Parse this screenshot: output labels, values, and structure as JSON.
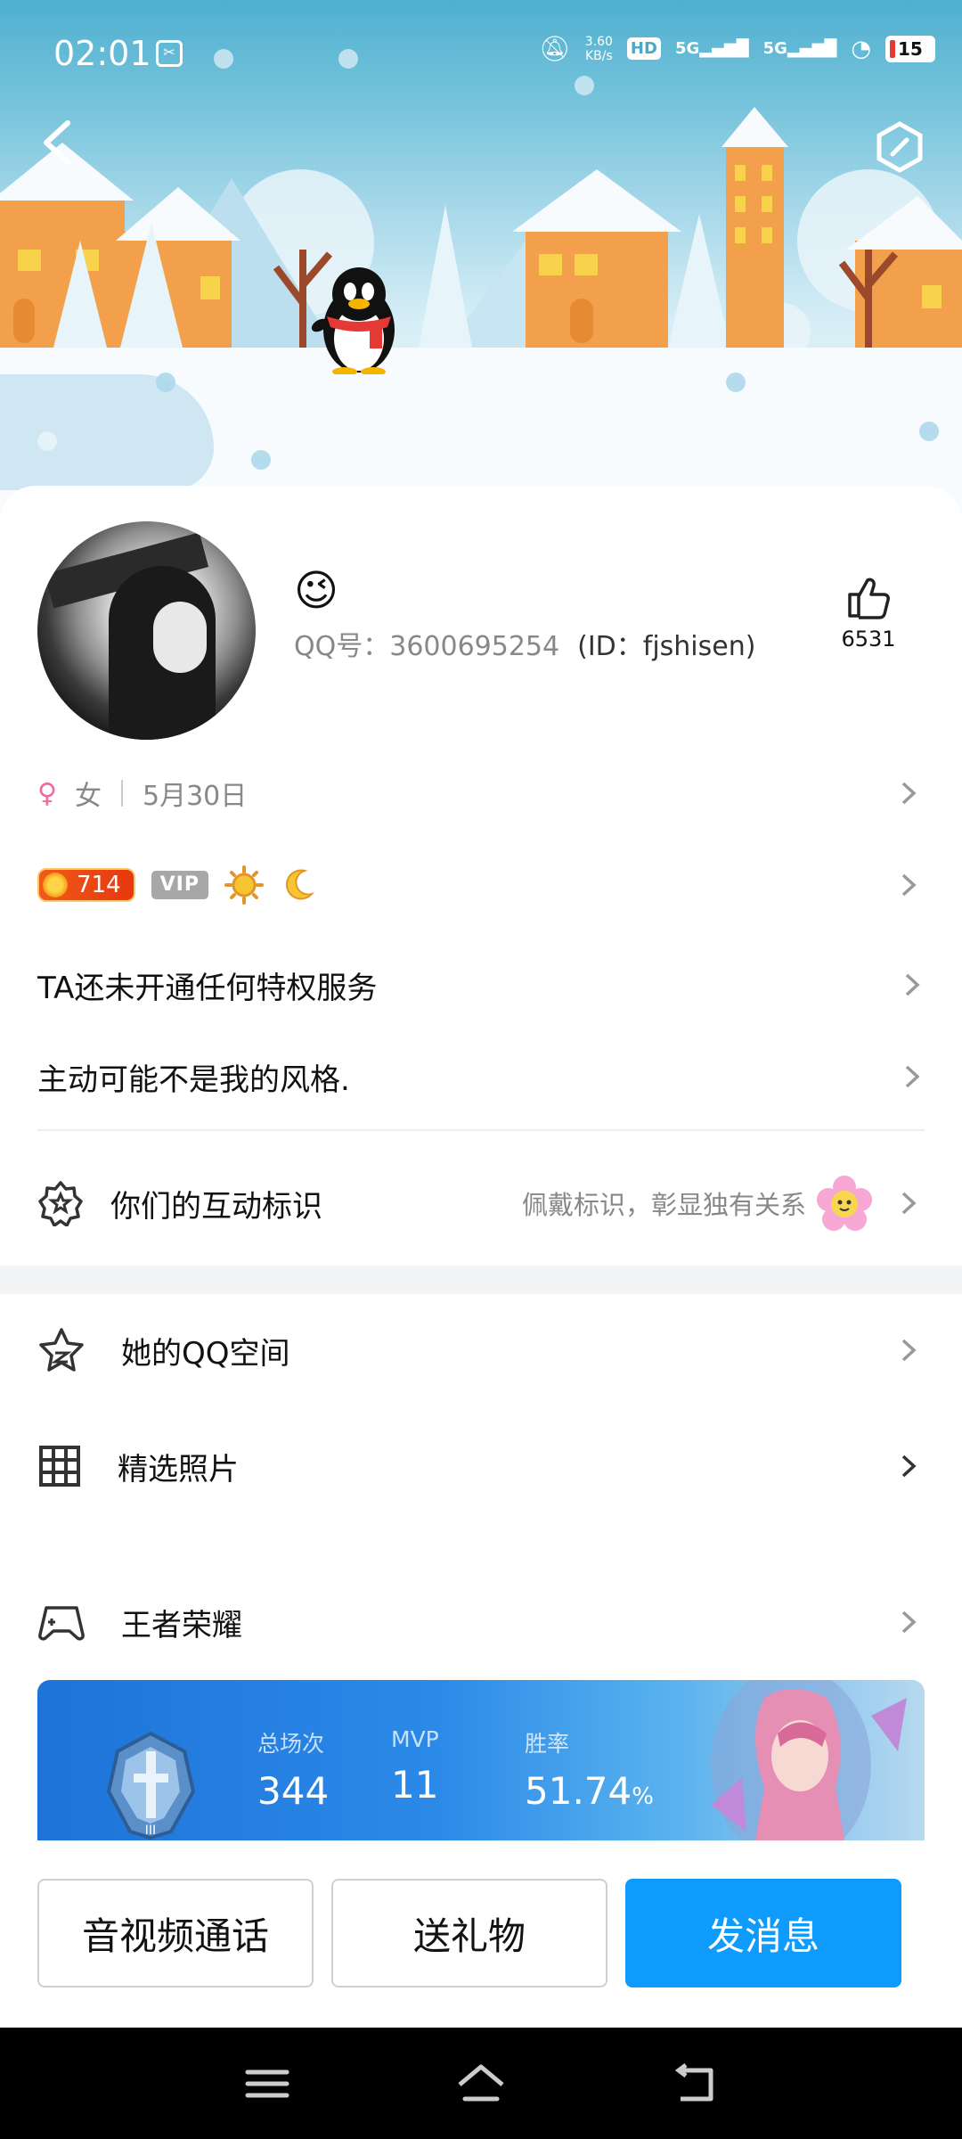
{
  "status_bar": {
    "time": "02:01",
    "net_speed_value": "3.60",
    "net_speed_unit": "KB/s",
    "hd_label": "HD",
    "sim1_label": "5G",
    "sim2_label": "5G",
    "battery": "15"
  },
  "profile": {
    "name_emoji": "😉",
    "qq_label": "QQ号：3600695254",
    "id_label": "(ID：fjshisen)",
    "like_count": "6531",
    "gender": "女",
    "birthday": "5月30日",
    "level": "714",
    "vip_label": "VIP",
    "privilege_text": "TA还未开通任何特权服务",
    "bio": "主动可能不是我的风格."
  },
  "interaction": {
    "label": "你们的互动标识",
    "hint": "佩戴标识，彰显独有关系"
  },
  "menu": {
    "qzone": "她的QQ空间",
    "photos": "精选照片",
    "game": "王者荣耀"
  },
  "game_stats": {
    "total_label": "总场次",
    "total_value": "344",
    "mvp_label": "MVP",
    "mvp_value": "11",
    "winrate_label": "胜率",
    "winrate_value": "51.74",
    "winrate_unit": "%"
  },
  "actions": {
    "call": "音视频通话",
    "gift": "送礼物",
    "message": "发消息"
  },
  "colors": {
    "accent": "#0f9bfb",
    "scene_sky": "#4fb0cf",
    "level_badge": "#e8380d"
  }
}
